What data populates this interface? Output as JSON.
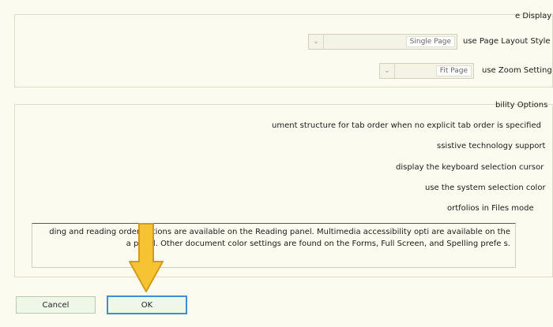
{
  "display_group": {
    "title": "e Display",
    "page_layout_label": "use Page Layout Style",
    "page_layout_value": "Single Page",
    "zoom_label": "use Zoom Setting",
    "zoom_value": "Fit Page"
  },
  "accessibility_group": {
    "title": "bility Options",
    "options": [
      "ument structure for tab order when no explicit tab order is specified",
      "ssistive technology support",
      "display the keyboard selection cursor",
      "use the system selection color",
      "ortfolios in Files mode"
    ],
    "info_lines": [
      "ding and reading order options are available on the Reading panel. Multimedia accessibility opti    are available on the",
      "a panel. Other document color settings are found on the Forms, Full Screen, and Spelling prefe      s."
    ]
  },
  "buttons": {
    "ok": "OK",
    "cancel": "Cancel"
  },
  "colors": {
    "background": "#fbfcef",
    "ok_border": "#3d8fd0",
    "arrow_fill": "#f6c433",
    "arrow_stroke": "#d49b1a"
  },
  "icons": {
    "dropdown": "chevron-down-icon",
    "overlay": "down-arrow-icon"
  }
}
